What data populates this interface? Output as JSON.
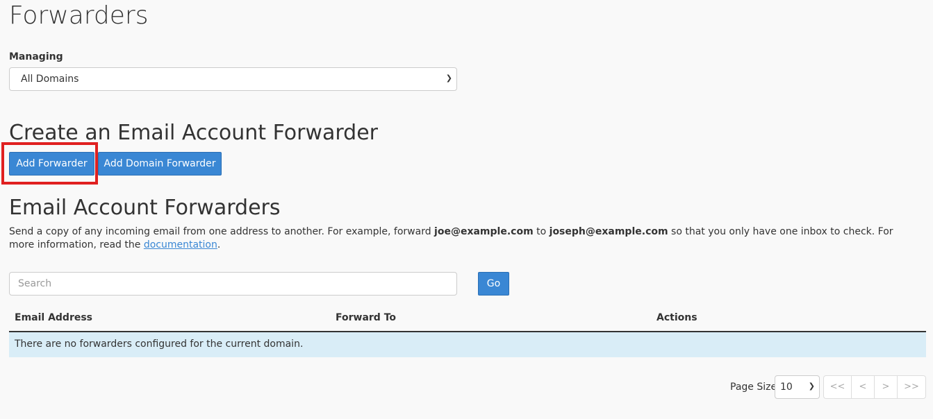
{
  "title": "Forwarders",
  "managing": {
    "label": "Managing",
    "selected": "All Domains"
  },
  "create": {
    "heading": "Create an Email Account Forwarder",
    "add_forwarder": "Add Forwarder",
    "add_domain_forwarder": "Add Domain Forwarder"
  },
  "list": {
    "heading": "Email Account Forwarders",
    "desc_1": "Send a copy of any incoming email from one address to another. For example, forward ",
    "example_from": "joe@example.com",
    "desc_2": " to ",
    "example_to": "joseph@example.com",
    "desc_3": " so that you only have one inbox to check. For more information, read the ",
    "doc_link": "documentation",
    "desc_4": ".",
    "search_placeholder": "Search",
    "go": "Go",
    "columns": [
      "Email Address",
      "Forward To",
      "Actions"
    ],
    "empty": "There are no forwarders configured for the current domain."
  },
  "pagination": {
    "page_size_label": "Page Size",
    "page_size": "10",
    "first": "<<",
    "prev": "<",
    "next": ">",
    "last": ">>"
  },
  "colors": {
    "primary": "#3a87d4",
    "highlight": "#e02020",
    "empty_row": "#d9edf7"
  }
}
